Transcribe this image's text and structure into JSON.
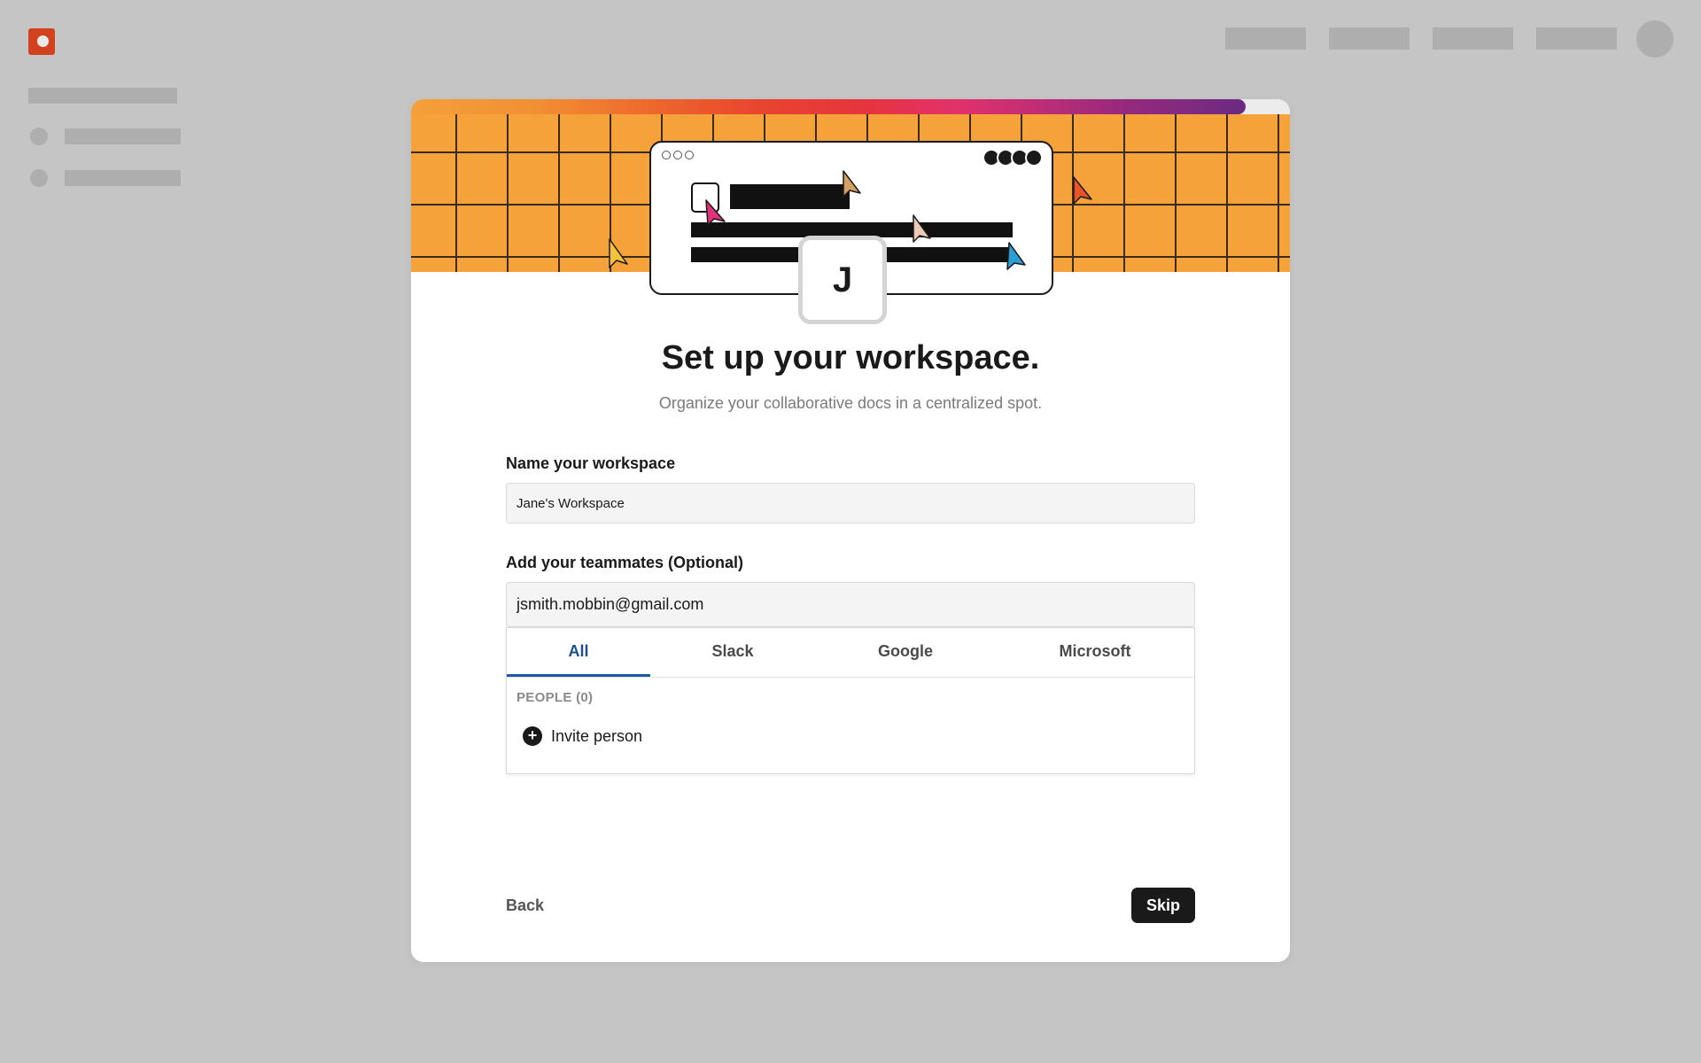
{
  "workspace": {
    "avatar_letter": "J",
    "title": "Set up your workspace.",
    "subtitle": "Organize your collaborative docs in a centralized spot.",
    "progress": 0.95,
    "name_label": "Name your workspace",
    "name_value": "Jane's Workspace",
    "teammates_label": "Add your teammates (Optional)",
    "teammates_value": "jsmith.mobbin@gmail.com",
    "tabs": [
      {
        "label": "All",
        "active": true
      },
      {
        "label": "Slack",
        "active": false
      },
      {
        "label": "Google",
        "active": false
      },
      {
        "label": "Microsoft",
        "active": false
      }
    ],
    "people_section": "PEOPLE (0)",
    "invite_label": "Invite person",
    "back_label": "Back",
    "skip_label": "Skip"
  },
  "colors": {
    "brand": "#d2421f",
    "hero_background": "#f6a23a",
    "active_tab": "#1c4f91",
    "primary_button": "#1a1a1a"
  },
  "icons": {
    "logo": "app-logo-icon",
    "invite": "plus-circle-icon"
  }
}
